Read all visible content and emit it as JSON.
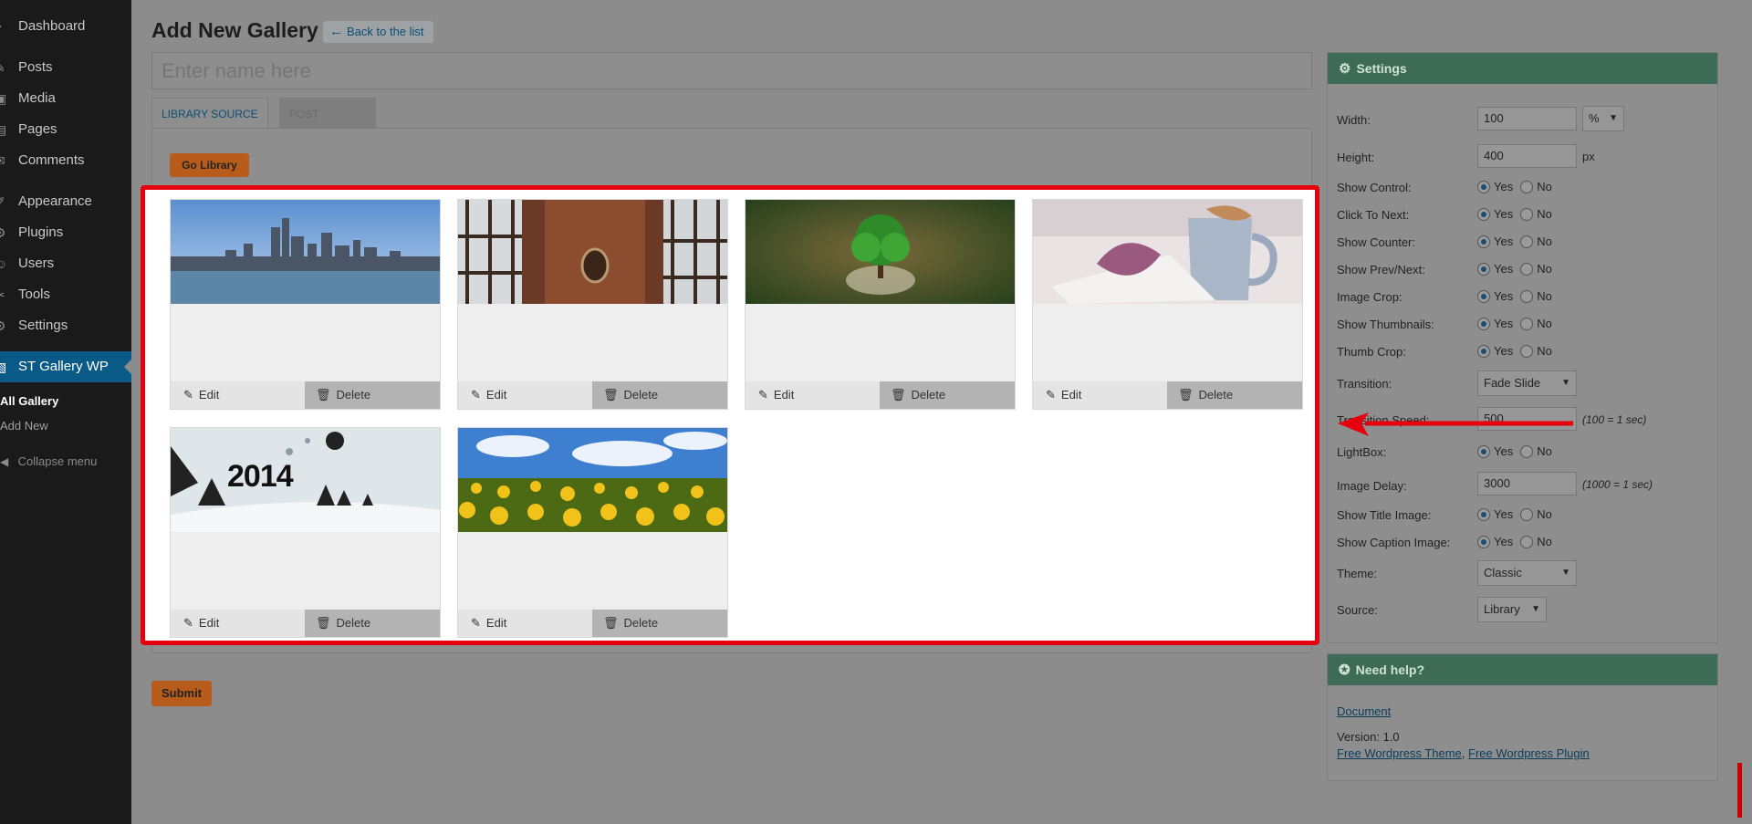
{
  "sidebar": {
    "items": [
      {
        "label": "Dashboard",
        "icon": "dashboard-icon",
        "glyph": "◔"
      },
      {
        "label": "Posts",
        "icon": "pin-icon",
        "glyph": "✎"
      },
      {
        "label": "Media",
        "icon": "media-icon",
        "glyph": "▣"
      },
      {
        "label": "Pages",
        "icon": "pages-icon",
        "glyph": "▤"
      },
      {
        "label": "Comments",
        "icon": "comments-icon",
        "glyph": "✉"
      },
      {
        "label": "Appearance",
        "icon": "appearance-icon",
        "glyph": "✐"
      },
      {
        "label": "Plugins",
        "icon": "plugins-icon",
        "glyph": "⚙"
      },
      {
        "label": "Users",
        "icon": "users-icon",
        "glyph": "☺"
      },
      {
        "label": "Tools",
        "icon": "tools-icon",
        "glyph": "✂"
      },
      {
        "label": "Settings",
        "icon": "settings-icon",
        "glyph": "⚙"
      },
      {
        "label": "ST Gallery WP",
        "icon": "gallery-icon",
        "glyph": "▧"
      }
    ],
    "submenu": [
      "All Gallery",
      "Add New"
    ],
    "collapse_label": "Collapse menu"
  },
  "header": {
    "title": "Add New Gallery",
    "back_label": "Back to the list"
  },
  "name_input": {
    "placeholder": "Enter name here"
  },
  "tabs": {
    "library": "LIBRARY SOURCE",
    "post": "POST SOURCE"
  },
  "go_library_label": "Go Library",
  "gallery": {
    "edit_label": "Edit",
    "delete_label": "Delete",
    "images": [
      "city-skyline",
      "vintage-room",
      "tree-in-glass",
      "cup-and-leaf",
      "new-year-2014",
      "sunflower-field"
    ],
    "new_year_text": "2014"
  },
  "submit_label": "Submit",
  "settings": {
    "title": "Settings",
    "width_label": "Width:",
    "width_value": "100",
    "width_unit": "%",
    "height_label": "Height:",
    "height_value": "400",
    "height_unit": "px",
    "yes": "Yes",
    "no": "No",
    "show_control": "Show Control:",
    "click_to_next": "Click To Next:",
    "show_counter": "Show Counter:",
    "show_prev_next": "Show Prev/Next:",
    "image_crop": "Image Crop:",
    "show_thumbnails": "Show Thumbnails:",
    "thumb_crop": "Thumb Crop:",
    "transition_label": "Transition:",
    "transition_value": "Fade Slide",
    "transition_speed_label": "Transition Speed:",
    "transition_speed_value": "500",
    "transition_speed_hint": "(100 = 1 sec)",
    "lightbox": "LightBox:",
    "image_delay_label": "Image Delay:",
    "image_delay_value": "3000",
    "image_delay_hint": "(1000 = 1 sec)",
    "show_title_image": "Show Title Image:",
    "show_caption_image": "Show Caption Image:",
    "theme_label": "Theme:",
    "theme_value": "Classic",
    "source_label": "Source:",
    "source_value": "Library"
  },
  "help": {
    "title": "Need help?",
    "document_link": "Document",
    "version": "Version: 1.0",
    "theme_link": "Free Wordpress Theme",
    "separator": ", ",
    "plugin_link": "Free Wordpress Plugin"
  },
  "colors": {
    "accent_orange": "#b85c1c",
    "highlight_red": "#e6000e",
    "sidebar_active": "#0a5a88",
    "box_header": "#3d6b55"
  }
}
